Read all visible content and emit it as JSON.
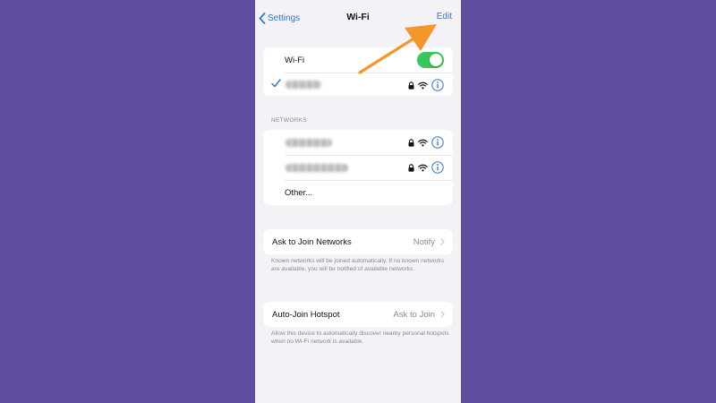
{
  "nav": {
    "back_label": "Settings",
    "title": "Wi-Fi",
    "edit_label": "Edit"
  },
  "wifi": {
    "label": "Wi-Fi",
    "enabled": true,
    "connected_network": {
      "name_blurred": true,
      "secured": true
    }
  },
  "networks": {
    "header": "NETWORKS",
    "items": [
      {
        "name_blurred": true,
        "secured": true
      },
      {
        "name_blurred": true,
        "secured": true
      }
    ],
    "other_label": "Other..."
  },
  "ask_to_join": {
    "label": "Ask to Join Networks",
    "value": "Notify",
    "footnote": "Known networks will be joined automatically. If no known networks are available, you will be notified of available networks."
  },
  "auto_join": {
    "label": "Auto-Join Hotspot",
    "value": "Ask to Join",
    "footnote": "Allow this device to automatically discover nearby personal hotspots when no Wi-Fi network is available."
  },
  "colors": {
    "background": "#604c9e",
    "panel": "#f2f2f7",
    "accent_blue": "#3478c6",
    "toggle_green": "#34c759",
    "annotation_arrow": "#f5962a"
  },
  "icons": [
    "chevron-left-icon",
    "checkmark-icon",
    "lock-icon",
    "wifi-icon",
    "info-icon",
    "chevron-right-icon",
    "annotation-arrow"
  ]
}
